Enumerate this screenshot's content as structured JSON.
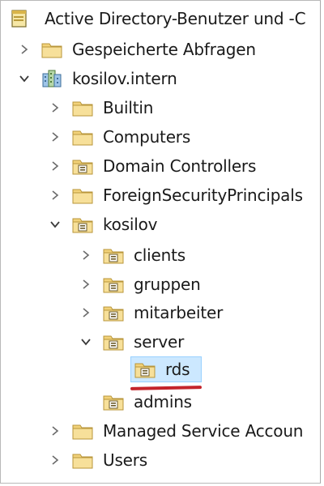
{
  "root": {
    "label": "Active Directory-Benutzer und -C",
    "icon": "ad-console-icon"
  },
  "tree": [
    {
      "id": "saved-queries",
      "label": "Gespeicherte Abfragen",
      "icon": "folder-icon",
      "state": "collapsed"
    },
    {
      "id": "domain",
      "label": "kosilov.intern",
      "icon": "domain-icon",
      "state": "expanded"
    },
    {
      "id": "builtin",
      "label": "Builtin",
      "icon": "folder-icon",
      "state": "collapsed"
    },
    {
      "id": "computers",
      "label": "Computers",
      "icon": "folder-icon",
      "state": "collapsed"
    },
    {
      "id": "domain-controllers",
      "label": "Domain Controllers",
      "icon": "ou-icon",
      "state": "collapsed"
    },
    {
      "id": "foreign-security-principals",
      "label": "ForeignSecurityPrincipals",
      "icon": "folder-icon",
      "state": "collapsed"
    },
    {
      "id": "kosilov",
      "label": "kosilov",
      "icon": "ou-icon",
      "state": "expanded"
    },
    {
      "id": "clients",
      "label": "clients",
      "icon": "ou-icon",
      "state": "collapsed"
    },
    {
      "id": "gruppen",
      "label": "gruppen",
      "icon": "ou-icon",
      "state": "collapsed"
    },
    {
      "id": "mitarbeiter",
      "label": "mitarbeiter",
      "icon": "ou-icon",
      "state": "collapsed"
    },
    {
      "id": "server",
      "label": "server",
      "icon": "ou-icon",
      "state": "expanded"
    },
    {
      "id": "rds",
      "label": "rds",
      "icon": "ou-icon",
      "state": "leaf",
      "selected": true
    },
    {
      "id": "admins",
      "label": "admins",
      "icon": "ou-icon",
      "state": "leaf"
    },
    {
      "id": "managed-service-accounts",
      "label": "Managed Service Accoun",
      "icon": "folder-icon",
      "state": "collapsed"
    },
    {
      "id": "users",
      "label": "Users",
      "icon": "folder-icon",
      "state": "collapsed"
    }
  ],
  "colors": {
    "selection": "#cce8ff",
    "selection_border": "#99d1ff",
    "annotation_underline": "#c4242b",
    "folder": "#f2d27a"
  }
}
